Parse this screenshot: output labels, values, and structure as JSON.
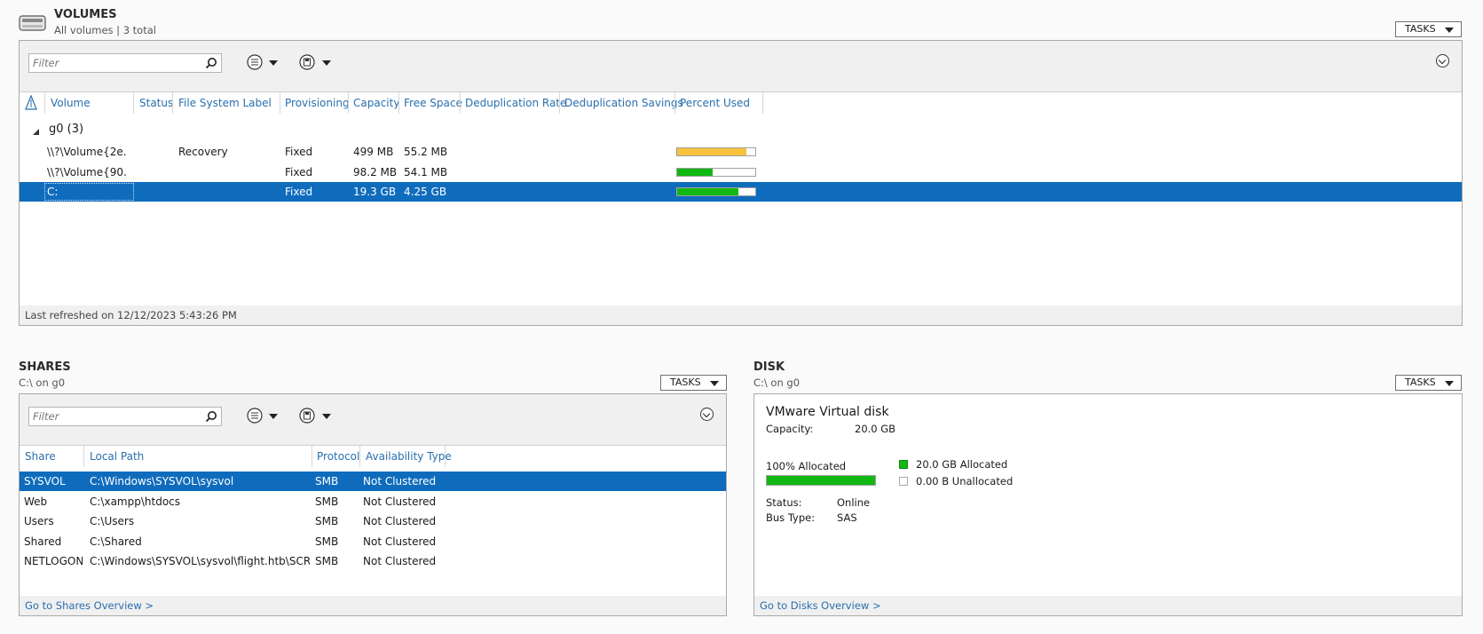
{
  "colors": {
    "selection": "#0f6cbd",
    "link": "#2a6fad",
    "bar_warn": "#f7c33c",
    "bar_ok": "#11b813"
  },
  "volumes": {
    "title": "VOLUMES",
    "subtitle": "All volumes | 3 total",
    "tasks_label": "TASKS",
    "filter_placeholder": "Filter",
    "columns": [
      "Volume",
      "Status",
      "File System Label",
      "Provisioning",
      "Capacity",
      "Free Space",
      "Deduplication Rate",
      "Deduplication Savings",
      "Percent Used"
    ],
    "group_label": "g0 (3)",
    "rows": [
      {
        "volume": "\\\\?\\Volume{2e...",
        "status": "",
        "label": "Recovery",
        "provisioning": "Fixed",
        "capacity": "499 MB",
        "free": "55.2 MB",
        "percent_used": 89,
        "bar_color": "#f7c33c"
      },
      {
        "volume": "\\\\?\\Volume{90...",
        "status": "",
        "label": "",
        "provisioning": "Fixed",
        "capacity": "98.2 MB",
        "free": "54.1 MB",
        "percent_used": 45,
        "bar_color": "#11b813"
      },
      {
        "volume": "C:",
        "status": "",
        "label": "",
        "provisioning": "Fixed",
        "capacity": "19.3 GB",
        "free": "4.25 GB",
        "percent_used": 78,
        "bar_color": "#11b813",
        "selected": true
      }
    ],
    "last_refreshed": "Last refreshed on 12/12/2023 5:43:26 PM"
  },
  "shares": {
    "title": "SHARES",
    "subtitle": "C:\\ on g0",
    "tasks_label": "TASKS",
    "filter_placeholder": "Filter",
    "columns": [
      "Share",
      "Local Path",
      "Protocol",
      "Availability Type"
    ],
    "rows": [
      {
        "share": "SYSVOL",
        "path": "C:\\Windows\\SYSVOL\\sysvol",
        "protocol": "SMB",
        "availability": "Not Clustered",
        "selected": true
      },
      {
        "share": "Web",
        "path": "C:\\xampp\\htdocs",
        "protocol": "SMB",
        "availability": "Not Clustered"
      },
      {
        "share": "Users",
        "path": "C:\\Users",
        "protocol": "SMB",
        "availability": "Not Clustered"
      },
      {
        "share": "Shared",
        "path": "C:\\Shared",
        "protocol": "SMB",
        "availability": "Not Clustered"
      },
      {
        "share": "NETLOGON",
        "path": "C:\\Windows\\SYSVOL\\sysvol\\flight.htb\\SCRIPTS",
        "protocol": "SMB",
        "availability": "Not Clustered"
      }
    ],
    "footer_link": "Go to Shares Overview >"
  },
  "disk": {
    "title": "DISK",
    "subtitle": "C:\\ on g0",
    "tasks_label": "TASKS",
    "name": "VMware Virtual disk",
    "capacity_label": "Capacity:",
    "capacity_value": "20.0 GB",
    "allocated_label": "100% Allocated",
    "allocated_percent": 100,
    "legend_allocated": "20.0 GB Allocated",
    "legend_unallocated": "0.00 B Unallocated",
    "status_label": "Status:",
    "status_value": "Online",
    "bus_label": "Bus Type:",
    "bus_value": "SAS",
    "footer_link": "Go to Disks Overview >"
  }
}
